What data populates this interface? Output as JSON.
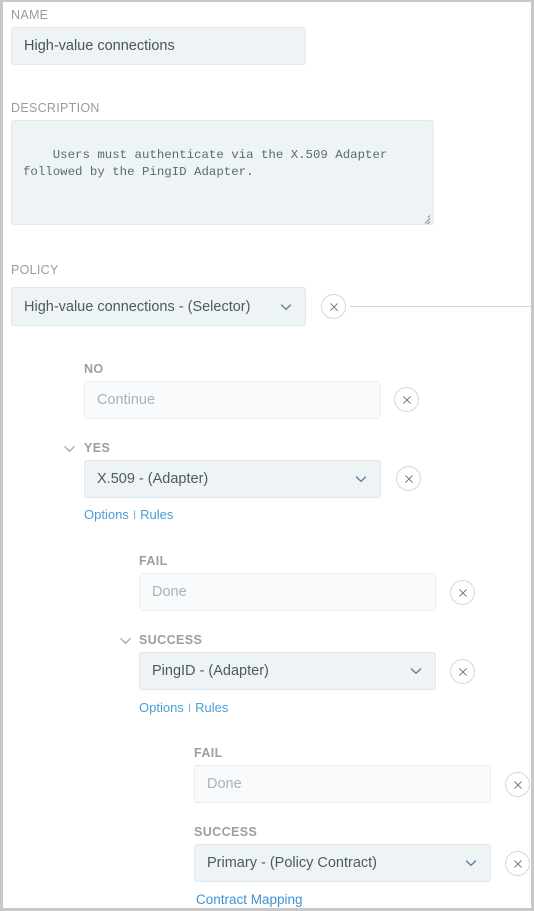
{
  "form": {
    "name": {
      "label": "NAME",
      "value": "High-value connections"
    },
    "description": {
      "label": "DESCRIPTION",
      "value": "Users must authenticate via the X.509 Adapter\nfollowed by the PingID Adapter."
    },
    "policy": {
      "label": "POLICY"
    }
  },
  "colors": {
    "link": "#4a9fd8",
    "field_bg": "#eef3f6",
    "label": "#9b9b9b",
    "panel_border": "#c8c8c8"
  },
  "tree": {
    "root": {
      "select_value": "High-value connections - (Selector)",
      "remove_label": "Remove"
    },
    "branches": [
      {
        "label": "NO",
        "has_chevron": false,
        "select_value": "",
        "placeholder": "Continue",
        "empty": true,
        "links": []
      },
      {
        "label": "YES",
        "has_chevron": true,
        "select_value": "X.509 - (Adapter)",
        "placeholder": "",
        "empty": false,
        "links": [
          "Options",
          "Rules"
        ]
      },
      {
        "label": "FAIL",
        "has_chevron": false,
        "select_value": "",
        "placeholder": "Done",
        "empty": true,
        "links": []
      },
      {
        "label": "SUCCESS",
        "has_chevron": true,
        "select_value": "PingID - (Adapter)",
        "placeholder": "",
        "empty": false,
        "links": [
          "Options",
          "Rules"
        ]
      },
      {
        "label": "FAIL",
        "has_chevron": false,
        "select_value": "",
        "placeholder": "Done",
        "empty": true,
        "links": []
      },
      {
        "label": "SUCCESS",
        "has_chevron": false,
        "select_value": "Primary - (Policy Contract)",
        "placeholder": "",
        "empty": false,
        "links": [
          "Contract Mapping"
        ]
      }
    ],
    "links_separator": "I"
  },
  "icons": {
    "remove": "close-icon",
    "dropdown": "chevron-down-icon",
    "collapse": "chevron-down-icon",
    "resize": "resize-handle-icon"
  }
}
